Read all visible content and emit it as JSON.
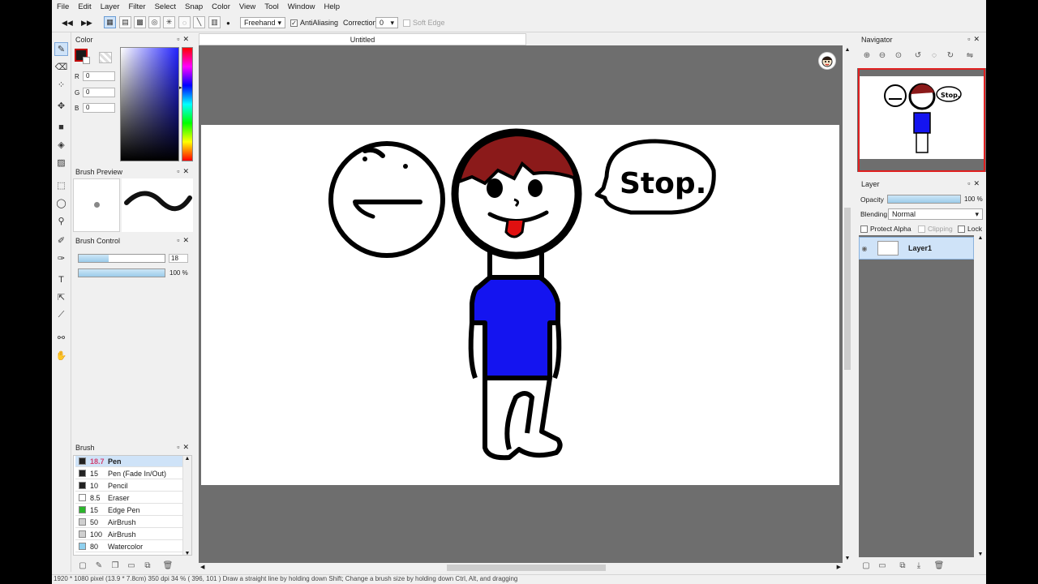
{
  "menu": [
    "File",
    "Edit",
    "Layer",
    "Filter",
    "Select",
    "Snap",
    "Color",
    "View",
    "Tool",
    "Window",
    "Help"
  ],
  "toolbar": {
    "brush_mode": "Freehand",
    "antialiasing_label": "AntiAliasing",
    "antialiasing_checked": true,
    "correction_label": "Correction",
    "correction_value": "0",
    "soft_edge_label": "Soft Edge",
    "soft_edge_checked": false
  },
  "color_panel": {
    "title": "Color",
    "r_label": "R",
    "r_value": "0",
    "g_label": "G",
    "g_value": "0",
    "b_label": "B",
    "b_value": "0",
    "foreground": "#1a1a1a",
    "accent_border": "#c00000"
  },
  "brush_preview": {
    "title": "Brush Preview"
  },
  "brush_control": {
    "title": "Brush Control",
    "size_value": "18",
    "size_level": 0.35,
    "opacity_value": "100 %",
    "opacity_level": 1.0
  },
  "brush_panel": {
    "title": "Brush",
    "items": [
      {
        "size": "18.7",
        "name": "Pen",
        "color": "#222222",
        "selected": true
      },
      {
        "size": "15",
        "name": "Pen (Fade In/Out)",
        "color": "#222222"
      },
      {
        "size": "10",
        "name": "Pencil",
        "color": "#222222"
      },
      {
        "size": "8.5",
        "name": "Eraser",
        "color": "#ffffff"
      },
      {
        "size": "15",
        "name": "Edge Pen",
        "color": "#2bb52b"
      },
      {
        "size": "50",
        "name": "AirBrush",
        "color": "#cfcfcf"
      },
      {
        "size": "100",
        "name": "AirBrush",
        "color": "#cfcfcf"
      },
      {
        "size": "80",
        "name": "Watercolor",
        "color": "#8fd0ee"
      }
    ]
  },
  "document": {
    "tab_title": "Untitled"
  },
  "drawing": {
    "speech_text": "Stop."
  },
  "navigator": {
    "title": "Navigator"
  },
  "layer_panel": {
    "title": "Layer",
    "opacity_label": "Opacity",
    "opacity_value": "100 %",
    "blending_label": "Blending",
    "blending_value": "Normal",
    "protect_alpha_label": "Protect Alpha",
    "clipping_label": "Clipping",
    "lock_label": "Lock",
    "layers": [
      {
        "name": "Layer1"
      }
    ]
  },
  "status": {
    "text": "1920 * 1080 pixel  (13.9 * 7.8cm)  350 dpi  34 %  ( 396, 101 )  Draw a straight line by holding down Shift; Change a brush size by holding down Ctrl, Alt, and dragging"
  }
}
